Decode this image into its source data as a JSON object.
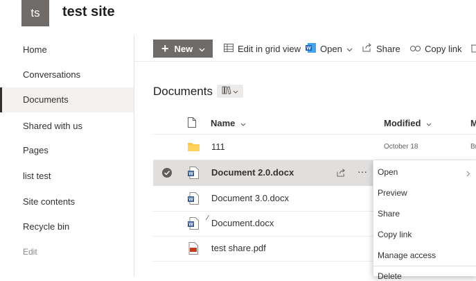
{
  "header": {
    "logo_initials": "ts",
    "site_title": "test site"
  },
  "nav": {
    "items": [
      {
        "label": "Home"
      },
      {
        "label": "Conversations"
      },
      {
        "label": "Documents"
      },
      {
        "label": "Shared with us"
      },
      {
        "label": "Pages"
      },
      {
        "label": "list test"
      },
      {
        "label": "Site contents"
      },
      {
        "label": "Recycle bin"
      }
    ],
    "active": "Documents",
    "edit_label": "Edit"
  },
  "toolbar": {
    "new_label": "New",
    "edit_grid_label": "Edit in grid view",
    "open_label": "Open",
    "share_label": "Share",
    "copy_link_label": "Copy link"
  },
  "library": {
    "title": "Documents"
  },
  "list": {
    "columns": {
      "name": "Name",
      "modified": "Modified",
      "extra": "M"
    },
    "rows": [
      {
        "name": "111",
        "type": "folder",
        "modified": "October 18",
        "extra": "Br"
      },
      {
        "name": "Document 2.0.docx",
        "type": "word",
        "modified": "",
        "selected": true
      },
      {
        "name": "Document 3.0.docx",
        "type": "word",
        "modified": ""
      },
      {
        "name": "Document.docx",
        "type": "word",
        "modified": ""
      },
      {
        "name": "test share.pdf",
        "type": "pdf",
        "modified": ""
      }
    ]
  },
  "context_menu": {
    "items": [
      {
        "label": "Open",
        "has_submenu": true
      },
      {
        "label": "Preview"
      },
      {
        "label": "Share"
      },
      {
        "label": "Copy link"
      },
      {
        "label": "Manage access"
      },
      {
        "label": "Delete"
      }
    ]
  },
  "colors": {
    "accent_gray": "#6f6b68",
    "word_blue": "#2b579a",
    "folder_yellow": "#ffc83d",
    "pdf_red": "#c43e1c"
  }
}
